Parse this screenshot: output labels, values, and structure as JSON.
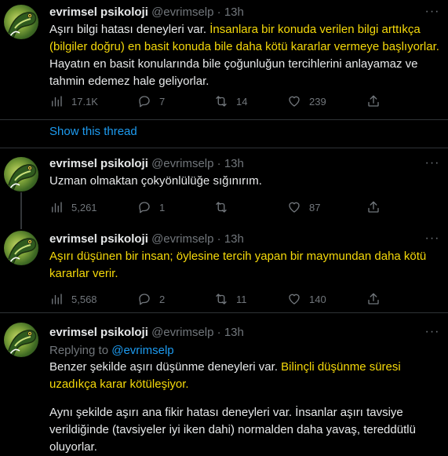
{
  "author": {
    "name": "evrimsel psikoloji",
    "handle": "@evrimselp",
    "sep": "·"
  },
  "tweets": [
    {
      "time": "13h",
      "text_segments": [
        {
          "t": "Aşırı bilgi hatası deneyleri var. ",
          "hl": false
        },
        {
          "t": "İnsanlara bir konuda verilen bilgi arttıkça (bilgiler doğru) en basit konuda bile daha kötü kararlar vermeye başlıyorlar.",
          "hl": true
        },
        {
          "t": " Hayatın en basit konularında bile çoğunluğun tercihlerini anlayamaz ve tahmin edemez hale geliyorlar.",
          "hl": false
        }
      ],
      "views": "17.1K",
      "replies": "7",
      "retweets": "14",
      "likes": "239"
    },
    {
      "time": "13h",
      "text_segments": [
        {
          "t": "Uzman olmaktan çokyönlülüğe sığınırım.",
          "hl": false
        }
      ],
      "views": "5,261",
      "replies": "1",
      "retweets": "",
      "likes": "87"
    },
    {
      "time": "13h",
      "text_segments": [
        {
          "t": "Aşırı düşünen bir insan; öylesine tercih yapan bir maymundan daha kötü kararlar verir.",
          "hl": true
        }
      ],
      "views": "5,568",
      "replies": "2",
      "retweets": "11",
      "likes": "140"
    },
    {
      "time": "13h",
      "replying_label": "Replying to",
      "replying_handle": "@evrimselp",
      "text_segments": [
        {
          "t": "Benzer şekilde aşırı düşünme deneyleri var. ",
          "hl": false
        },
        {
          "t": "Bilinçli düşünme süresi uzadıkça karar kötüleşiyor.",
          "hl": true
        }
      ],
      "text2": "Aynı şekilde aşırı ana fikir hatası deneyleri var. İnsanlar aşırı tavsiye verildiğinde (tavsiyeler iyi iken dahi) normalden daha yavaş, tereddütlü oluyorlar."
    }
  ],
  "show_thread": "Show this thread",
  "icons": {
    "views": "views-icon",
    "reply": "reply-icon",
    "retweet": "retweet-icon",
    "like": "like-icon",
    "share": "share-icon",
    "more": "more-icon"
  },
  "colors": {
    "highlight": "#f5d90a",
    "link": "#1d9bf0",
    "muted": "#71767b",
    "text": "#e7e9ea",
    "background": "#000000"
  }
}
